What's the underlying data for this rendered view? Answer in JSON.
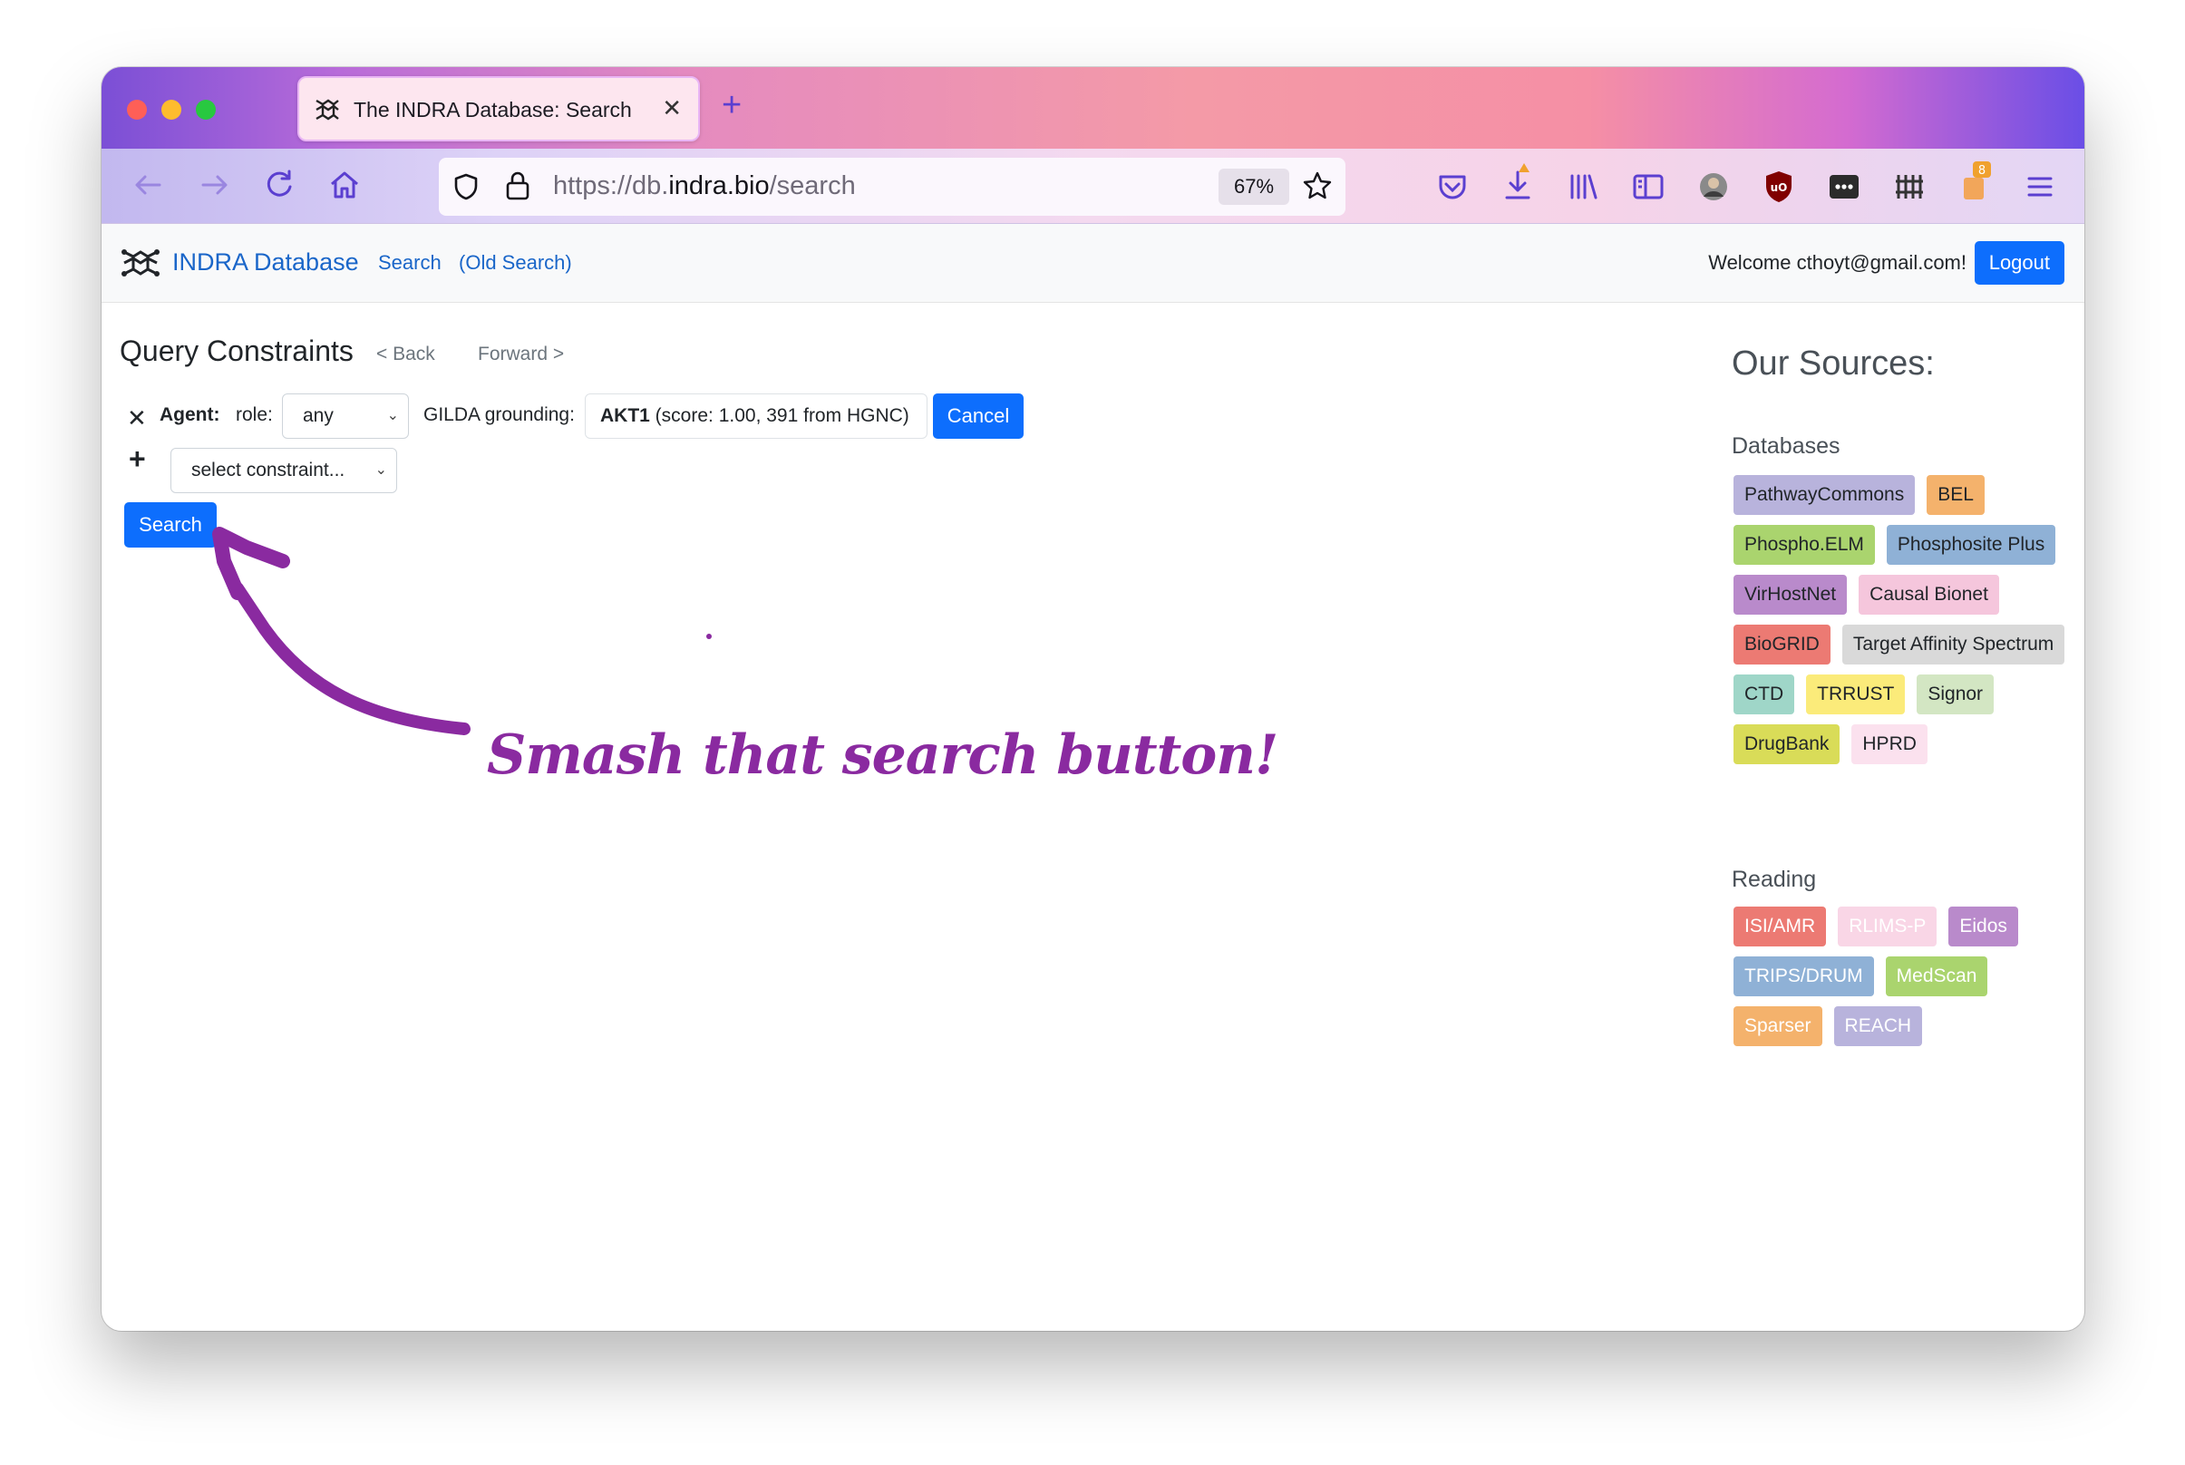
{
  "browser": {
    "tab_title": "The INDRA Database: Search",
    "url_prefix": "https://db.",
    "url_domain": "indra.bio",
    "url_path": "/search",
    "zoom": "67%",
    "download_badge": "8"
  },
  "site_nav": {
    "brand": "INDRA Database",
    "links": [
      "Search",
      "(Old Search)"
    ],
    "welcome": "Welcome cthoyt@gmail.com!",
    "logout": "Logout"
  },
  "query": {
    "title": "Query Constraints",
    "back": "< Back",
    "forward": "Forward >",
    "agent_label": "Agent:",
    "role_label": "role:",
    "role_value": "any",
    "grounding_label": "GILDA grounding:",
    "grounding_symbol": "AKT1",
    "grounding_detail": " (score: 1.00, 391 from HGNC)",
    "cancel": "Cancel",
    "constraint_placeholder": "select constraint...",
    "search": "Search"
  },
  "annotation": {
    "text": "Smash that search button!"
  },
  "sources": {
    "title": "Our Sources:",
    "databases_label": "Databases",
    "databases": [
      {
        "label": "PathwayCommons",
        "bg": "#b8b3dc",
        "fg": "#212529"
      },
      {
        "label": "BEL",
        "bg": "#f4b26c",
        "fg": "#212529"
      },
      {
        "label": "Phospho.ELM",
        "bg": "#aad46e",
        "fg": "#212529"
      },
      {
        "label": "Phosphosite Plus",
        "bg": "#8fb1d6",
        "fg": "#212529"
      },
      {
        "label": "VirHostNet",
        "bg": "#b98acb",
        "fg": "#212529"
      },
      {
        "label": "Causal Bionet",
        "bg": "#f5c6dc",
        "fg": "#212529"
      },
      {
        "label": "BioGRID",
        "bg": "#ec7a73",
        "fg": "#212529"
      },
      {
        "label": "Target Affinity Spectrum",
        "bg": "#d9d9d9",
        "fg": "#212529"
      },
      {
        "label": "CTD",
        "bg": "#9fd6c8",
        "fg": "#212529"
      },
      {
        "label": "TRRUST",
        "bg": "#fbeb7a",
        "fg": "#212529"
      },
      {
        "label": "Signor",
        "bg": "#d3e6c3",
        "fg": "#212529"
      },
      {
        "label": "DrugBank",
        "bg": "#d9dc58",
        "fg": "#212529"
      },
      {
        "label": "HPRD",
        "bg": "#fbe1ee",
        "fg": "#212529"
      }
    ],
    "reading_label": "Reading",
    "reading": [
      {
        "label": "ISI/AMR",
        "bg": "#ec7a73",
        "fg": "#ffffff"
      },
      {
        "label": "RLIMS-P",
        "bg": "#f9d6e6",
        "fg": "#ffffff"
      },
      {
        "label": "Eidos",
        "bg": "#b98acb",
        "fg": "#ffffff"
      },
      {
        "label": "TRIPS/DRUM",
        "bg": "#8fb1d6",
        "fg": "#ffffff"
      },
      {
        "label": "MedScan",
        "bg": "#aad46e",
        "fg": "#ffffff"
      },
      {
        "label": "Sparser",
        "bg": "#f4b26c",
        "fg": "#ffffff"
      },
      {
        "label": "REACH",
        "bg": "#b8b3dc",
        "fg": "#ffffff"
      }
    ]
  },
  "colors": {
    "accent": "#0d6efd",
    "link": "#1a66c9",
    "annotation": "#8a2aa0"
  }
}
